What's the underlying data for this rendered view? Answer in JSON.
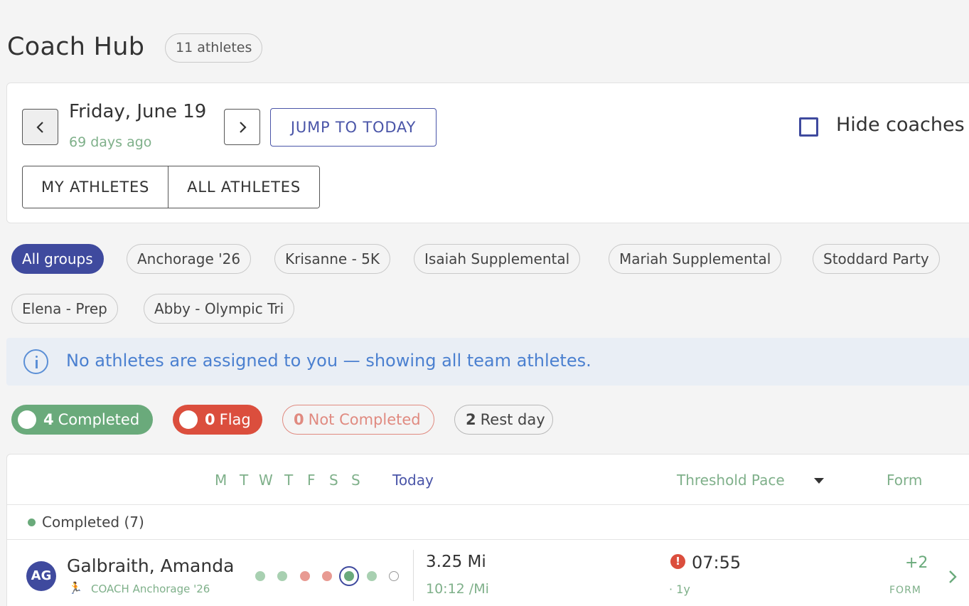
{
  "header": {
    "title": "Coach Hub",
    "athlete_count": "11 athletes"
  },
  "date_nav": {
    "date": "Friday, June 19",
    "relative": "69 days ago",
    "jump_label": "JUMP TO TODAY",
    "hide_coaches_label": "Hide coaches",
    "hide_coaches_checked": false
  },
  "view_toggle": {
    "my_athletes": "MY ATHLETES",
    "all_athletes": "ALL ATHLETES"
  },
  "groups": [
    "All groups",
    "Anchorage '26",
    "Krisanne - 5K",
    "Isaiah Supplemental",
    "Mariah Supplemental",
    "Stoddard Party",
    "Elena - Prep",
    "Abby - Olympic Tri"
  ],
  "info": {
    "message": "No athletes are assigned to you — showing all team athletes."
  },
  "status_filters": {
    "completed": {
      "count": "4",
      "label": "Completed"
    },
    "flag": {
      "count": "0",
      "label": "Flag"
    },
    "not_completed": {
      "count": "0",
      "label": "Not Completed"
    },
    "rest_day": {
      "count": "2",
      "label": "Rest day"
    }
  },
  "table": {
    "weekdays": [
      "M",
      "T",
      "W",
      "T",
      "F",
      "S",
      "S"
    ],
    "today_label": "Today",
    "threshold_label": "Threshold Pace",
    "form_label": "Form",
    "group_label": "Completed (7)"
  },
  "athlete": {
    "initials": "AG",
    "name": "Galbraith, Amanda",
    "role": "COACH",
    "group": "Anchorage '26",
    "week_status": [
      "done",
      "done",
      "missed",
      "missed",
      "current",
      "done",
      "empty"
    ],
    "distance": "3.25 Mi",
    "pace": "10:12 /Mi",
    "threshold_pace": "07:55",
    "threshold_age": "· 1y",
    "form_value": "+2",
    "form_label": "FORM"
  },
  "colors": {
    "accent": "#3f4a9e",
    "completed": "#6aaa7b",
    "flag": "#db4e3d",
    "info": "#4b80d0"
  }
}
